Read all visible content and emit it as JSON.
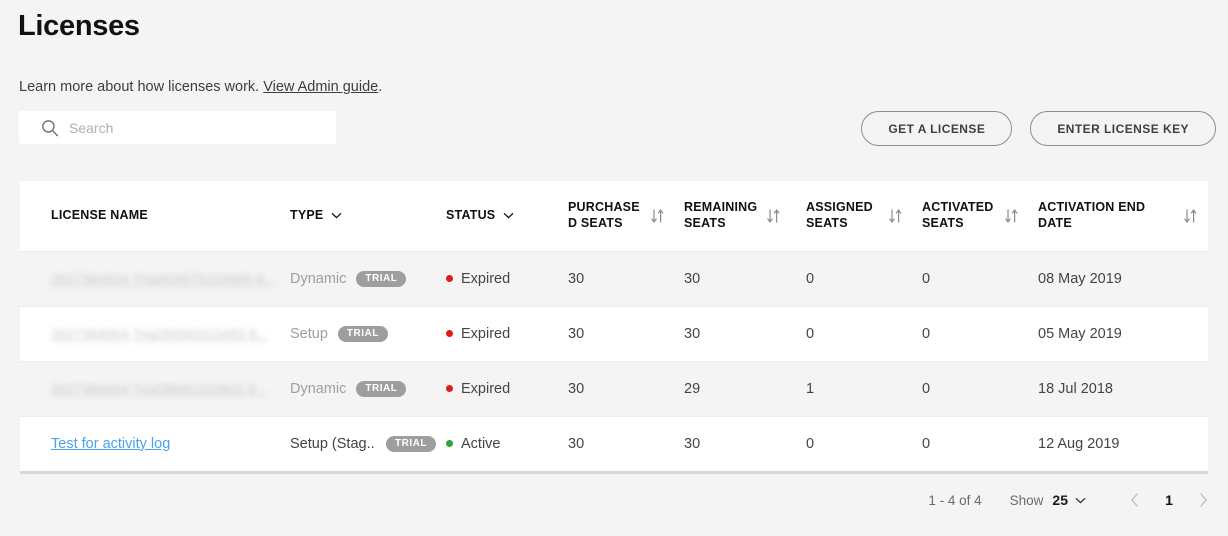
{
  "header": {
    "title": "Licenses",
    "subtitle_text": "Learn more about how licenses work.",
    "admin_guide_link": "View Admin guide",
    "subtitle_period": "."
  },
  "search": {
    "placeholder": "Search",
    "value": "",
    "icon": "search-icon"
  },
  "actions": {
    "get_license": "GET A LICENSE",
    "enter_key": "ENTER LICENSE KEY"
  },
  "table": {
    "columns": [
      {
        "label": "LICENSE NAME",
        "sortable": false,
        "filter": false
      },
      {
        "label": "TYPE",
        "sortable": false,
        "filter": true
      },
      {
        "label": "STATUS",
        "sortable": false,
        "filter": true
      },
      {
        "label": "PURCHASED SEATS",
        "sortable": true,
        "filter": false
      },
      {
        "label": "REMAINING SEATS",
        "sortable": true,
        "filter": false
      },
      {
        "label": "ASSIGNED SEATS",
        "sortable": true,
        "filter": false
      },
      {
        "label": "ACTIVATED SEATS",
        "sortable": true,
        "filter": false
      },
      {
        "label": "ACTIVATION END DATE",
        "sortable": true,
        "filter": false
      }
    ],
    "rows": [
      {
        "name": "2627384004 Trial404579154965 8...",
        "name_redacted": true,
        "type": "Dynamic",
        "badge": "TRIAL",
        "status": "Expired",
        "status_color": "#e01b1b",
        "purchased_seats": "30",
        "remaining_seats": "30",
        "assigned_seats": "0",
        "activated_seats": "0",
        "activation_end_date": "08 May 2019"
      },
      {
        "name": "2627384004 Trial39590315493 8...",
        "name_redacted": true,
        "type": "Setup",
        "badge": "TRIAL",
        "status": "Expired",
        "status_color": "#e01b1b",
        "purchased_seats": "30",
        "remaining_seats": "30",
        "assigned_seats": "0",
        "activated_seats": "0",
        "activation_end_date": "05 May 2019"
      },
      {
        "name": "2627384004 Trial38081152601 8...",
        "name_redacted": true,
        "type": "Dynamic",
        "badge": "TRIAL",
        "status": "Expired",
        "status_color": "#e01b1b",
        "purchased_seats": "30",
        "remaining_seats": "29",
        "assigned_seats": "1",
        "activated_seats": "0",
        "activation_end_date": "18 Jul 2018"
      },
      {
        "name": "Test for activity log",
        "name_redacted": false,
        "type": "Setup (Stag...",
        "badge": "TRIAL",
        "status": "Active",
        "status_color": "#2aa63a",
        "purchased_seats": "30",
        "remaining_seats": "30",
        "assigned_seats": "0",
        "activated_seats": "0",
        "activation_end_date": "12 Aug 2019"
      }
    ]
  },
  "pagination": {
    "range": "1 - 4 of 4",
    "show_label": "Show",
    "show_value": "25",
    "current_page": "1",
    "prev_icon": "chevron-left-icon",
    "next_icon": "chevron-right-icon"
  }
}
